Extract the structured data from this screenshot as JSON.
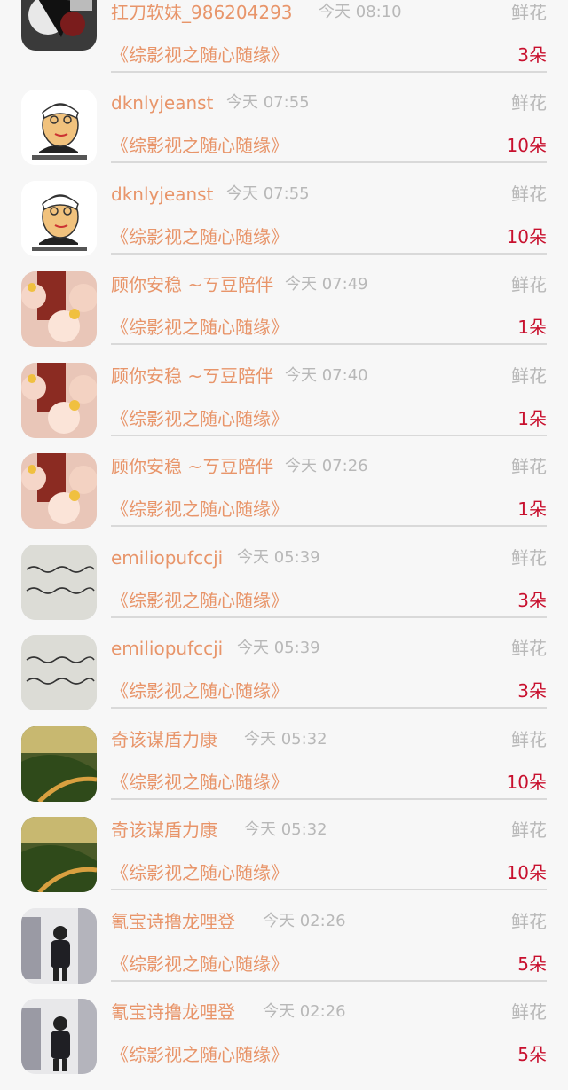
{
  "rows": [
    {
      "name": "扛刀软妹_986204293",
      "time": "今天 08:10",
      "gift": "鲜花",
      "book": "《综影视之随心随缘》",
      "count": "3朵",
      "avatar": "avatar-dark-portrait"
    },
    {
      "name": "dknlyjeanst",
      "time": "今天 07:55",
      "gift": "鲜花",
      "book": "《综影视之随心随缘》",
      "count": "10朵",
      "avatar": "avatar-cartoon-face"
    },
    {
      "name": "dknlyjeanst",
      "time": "今天 07:55",
      "gift": "鲜花",
      "book": "《综影视之随心随缘》",
      "count": "10朵",
      "avatar": "avatar-cartoon-face"
    },
    {
      "name": "顾你安稳 ~ㄎ豆陪伴",
      "time": "今天 07:49",
      "gift": "鲜花",
      "book": "《综影视之随心随缘》",
      "count": "1朵",
      "avatar": "avatar-selfie"
    },
    {
      "name": "顾你安稳 ~ㄎ豆陪伴",
      "time": "今天 07:40",
      "gift": "鲜花",
      "book": "《综影视之随心随缘》",
      "count": "1朵",
      "avatar": "avatar-selfie"
    },
    {
      "name": "顾你安稳 ~ㄎ豆陪伴",
      "time": "今天 07:26",
      "gift": "鲜花",
      "book": "《综影视之随心随缘》",
      "count": "1朵",
      "avatar": "avatar-selfie"
    },
    {
      "name": "emiliopufccji",
      "time": "今天 05:39",
      "gift": "鲜花",
      "book": "《综影视之随心随缘》",
      "count": "3朵",
      "avatar": "avatar-handwriting"
    },
    {
      "name": "emiliopufccji",
      "time": "今天 05:39",
      "gift": "鲜花",
      "book": "《综影视之随心随缘》",
      "count": "3朵",
      "avatar": "avatar-handwriting"
    },
    {
      "name": "奇该谋盾力康",
      "time": "今天 05:32",
      "gift": "鲜花",
      "book": "《综影视之随心随缘》",
      "count": "10朵",
      "avatar": "avatar-landscape"
    },
    {
      "name": "奇该谋盾力康",
      "time": "今天 05:32",
      "gift": "鲜花",
      "book": "《综影视之随心随缘》",
      "count": "10朵",
      "avatar": "avatar-landscape"
    },
    {
      "name": "氰宝诗撸龙哩登",
      "time": "今天 02:26",
      "gift": "鲜花",
      "book": "《综影视之随心随缘》",
      "count": "5朵",
      "avatar": "avatar-person-back"
    },
    {
      "name": "氰宝诗撸龙哩登",
      "time": "今天 02:26",
      "gift": "鲜花",
      "book": "《综影视之随心随缘》",
      "count": "5朵",
      "avatar": "avatar-person-back"
    }
  ]
}
